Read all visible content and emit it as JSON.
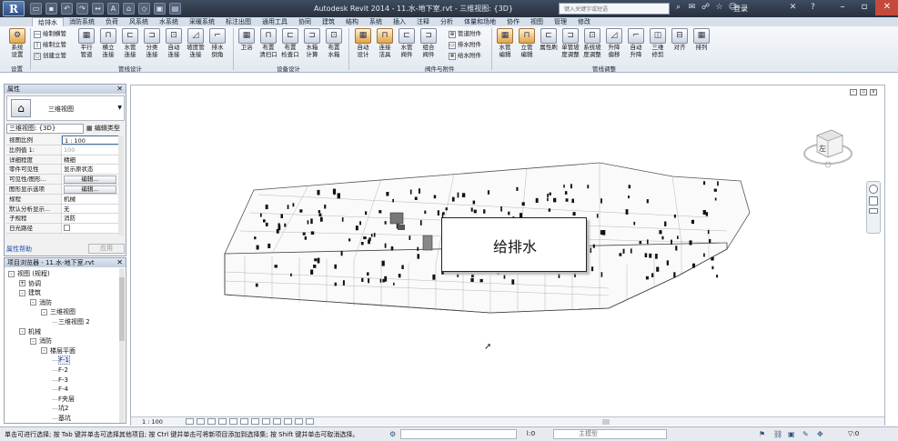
{
  "app": {
    "logo": "R",
    "window_title": "Autodesk Revit 2014 -     11.水-地下室.rvt - 三维视图: {3D}",
    "search_placeholder": "键入关键字或短语",
    "login": "登录",
    "qat_icons": [
      "open-icon",
      "save-icon",
      "undo-icon",
      "redo-icon",
      "measure-icon",
      "text-icon",
      "3d-view-icon",
      "section-icon"
    ]
  },
  "ribbon_tabs": [
    "给排水",
    "消防系统",
    "负荷",
    "风系统",
    "水系统",
    "采暖系统",
    "标注出图",
    "通用工具",
    "协同",
    "建筑",
    "结构",
    "系统",
    "插入",
    "注释",
    "分析",
    "体量和场地",
    "协作",
    "视图",
    "管理",
    "修改"
  ],
  "ribbon": {
    "setup_panel": {
      "label": "设置",
      "button": "系统\n设置"
    },
    "pipe_design_panel": {
      "label": "管线设计",
      "small_items": [
        "绘制横管",
        "绘制立管",
        "创建立管"
      ],
      "buttons": [
        "平行\n管道",
        "横立\n连接",
        "水管\n连接",
        "分类\n连接",
        "自动\n连接",
        "坡度管\n连接",
        "排水\n倒角"
      ]
    },
    "equipment_panel": {
      "label": "设备设计",
      "buttons": [
        "卫浴",
        "布置\n清扫口",
        "布置\n检查口",
        "水箱\n计算",
        "布置\n水箱"
      ]
    },
    "valve_panel": {
      "label": "阀件与附件",
      "buttons": [
        "自动\n设计",
        "连接\n洁具",
        "水管\n阀件",
        "组合\n阀件"
      ],
      "small_items": [
        "管道附件",
        "排水附件",
        "给水附件"
      ]
    },
    "pipe_adjust_panel": {
      "label": "管线调整",
      "buttons": [
        "水管\n编辑",
        "立管\n编辑",
        "属性刷",
        "单管坡\n度调整",
        "系统坡\n度调整",
        "升降\n偏移",
        "自动\n升降",
        "三维\n修剪",
        "对齐",
        "排列"
      ]
    }
  },
  "properties": {
    "title": "属性",
    "type_name": "三维视图",
    "instance_selector": "三维视图: {3D}",
    "edit_type": "编辑类型",
    "rows": [
      {
        "name": "视图比例",
        "value": "1 : 100",
        "style": "highlight"
      },
      {
        "name": "比例值 1:",
        "value": "100",
        "style": "gray"
      },
      {
        "name": "详细程度",
        "value": "精细",
        "style": ""
      },
      {
        "name": "零件可见性",
        "value": "显示原状态",
        "style": ""
      },
      {
        "name": "可见性/图形...",
        "value": "编辑...",
        "style": "button"
      },
      {
        "name": "图形显示选项",
        "value": "编辑...",
        "style": "button"
      },
      {
        "name": "规程",
        "value": "机械",
        "style": ""
      },
      {
        "name": "默认分析显示...",
        "value": "无",
        "style": ""
      },
      {
        "name": "子规程",
        "value": "消防",
        "style": ""
      },
      {
        "name": "日光路径",
        "value": "",
        "style": "checkbox"
      }
    ],
    "help_link": "属性帮助",
    "apply": "应用"
  },
  "browser": {
    "title": "项目浏览器 - 11.水-地下室.rvt",
    "nodes": [
      {
        "label": "视图 (规程)",
        "level": 0,
        "exp": "-"
      },
      {
        "label": "协调",
        "level": 1,
        "exp": "+"
      },
      {
        "label": "建筑",
        "level": 1,
        "exp": "-"
      },
      {
        "label": "消防",
        "level": 2,
        "exp": "-"
      },
      {
        "label": "三维视图",
        "level": 3,
        "exp": "-"
      },
      {
        "label": "三维视图 2",
        "level": 4,
        "exp": ""
      },
      {
        "label": "机械",
        "level": 1,
        "exp": "-"
      },
      {
        "label": "消防",
        "level": 2,
        "exp": "-"
      },
      {
        "label": "楼层平面",
        "level": 3,
        "exp": "-"
      },
      {
        "label": "F-1",
        "level": 4,
        "exp": "",
        "selected": true
      },
      {
        "label": "F-2",
        "level": 4,
        "exp": ""
      },
      {
        "label": "F-3",
        "level": 4,
        "exp": ""
      },
      {
        "label": "F-4",
        "level": 4,
        "exp": ""
      },
      {
        "label": "F夹层",
        "level": 4,
        "exp": ""
      },
      {
        "label": "坑2",
        "level": 4,
        "exp": ""
      },
      {
        "label": "基坑",
        "level": 4,
        "exp": ""
      }
    ]
  },
  "view": {
    "callout_text": "给排水",
    "viewcube_face": "左",
    "scale": "1 : 100"
  },
  "status": {
    "text": "单击可进行选择; 按 Tab 键并单击可选择其他项目; 按 Ctrl 键并单击可将新项目添加到选择集; 按 Shift 键并单击可取消选择。",
    "count": ":0",
    "model": "主模型",
    "count2": ":0"
  }
}
